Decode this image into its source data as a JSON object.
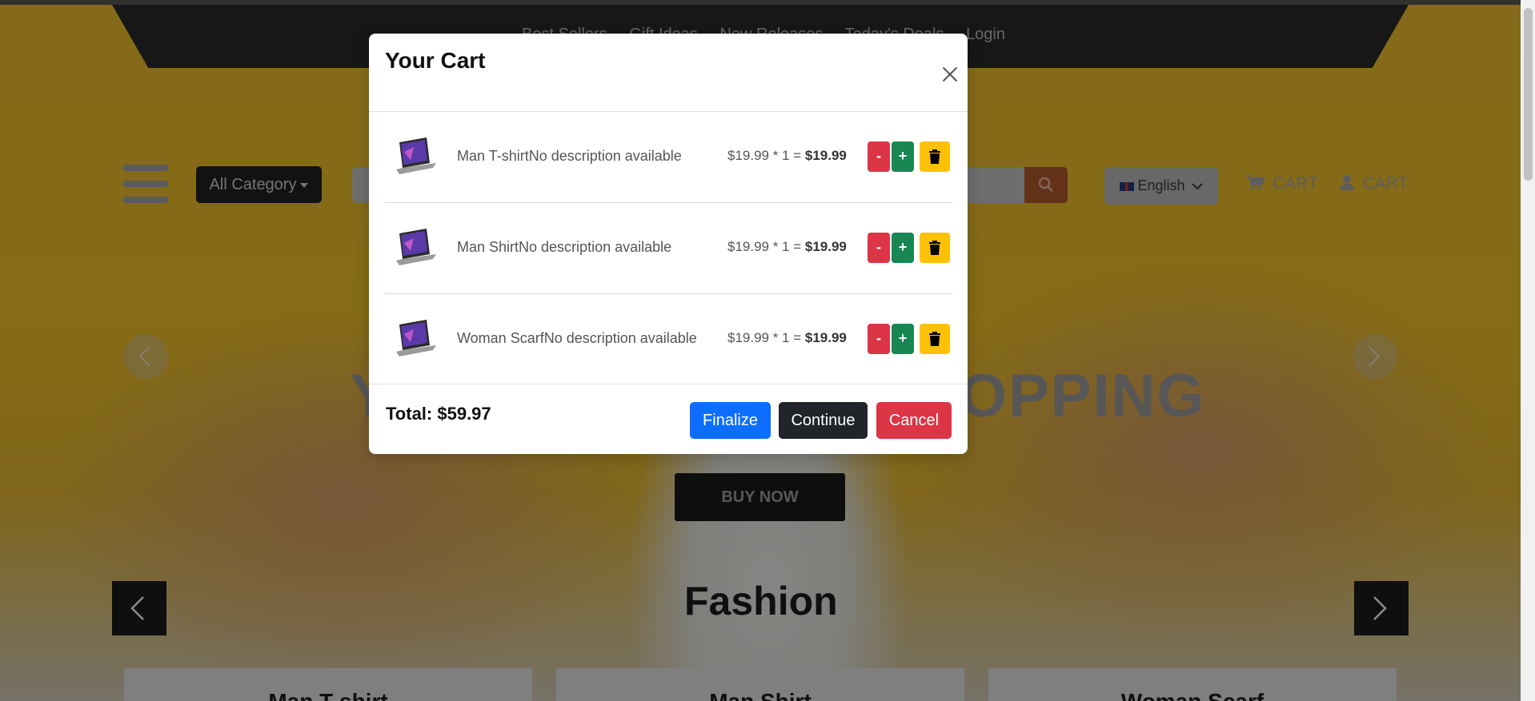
{
  "nav": {
    "links": [
      "Best Sellers",
      "Gift Ideas",
      "New Releases",
      "Today's Deals",
      "Login"
    ]
  },
  "header": {
    "category_label": "All Category",
    "language_label": "English",
    "cart_label_1": "CART",
    "cart_label_2": "CART"
  },
  "hero": {
    "headline_left": "Y",
    "headline_right": "OPPING",
    "buy_now_label": "BUY NOW",
    "section_title": "Fashion"
  },
  "products": {
    "cards": [
      "Man T shirt",
      "Man Shirt",
      "Woman Scarf"
    ]
  },
  "cart_modal": {
    "title": "Your Cart",
    "items": [
      {
        "name": "Man T-shirtNo description available",
        "price_expr": "$19.99 * 1 = ",
        "subtotal": "$19.99",
        "minus": "-",
        "plus": "+"
      },
      {
        "name": "Man ShirtNo description available",
        "price_expr": "$19.99 * 1 = ",
        "subtotal": "$19.99",
        "minus": "-",
        "plus": "+"
      },
      {
        "name": "Woman ScarfNo description available",
        "price_expr": "$19.99 * 1 = ",
        "subtotal": "$19.99",
        "minus": "-",
        "plus": "+"
      }
    ],
    "total_label": "Total: $59.97",
    "finalize_label": "Finalize",
    "continue_label": "Continue",
    "cancel_label": "Cancel"
  },
  "colors": {
    "finalize": "#0d6efd",
    "continue": "#212529",
    "cancel": "#dc3545",
    "minus": "#dc3545",
    "plus": "#198754",
    "trash": "#ffc107"
  },
  "icons": [
    "hamburger-menu-icon",
    "search-icon",
    "cart-icon",
    "user-icon",
    "chevron-left-icon",
    "chevron-right-icon",
    "close-icon",
    "trash-icon",
    "laptop-icon",
    "flag-icon"
  ]
}
